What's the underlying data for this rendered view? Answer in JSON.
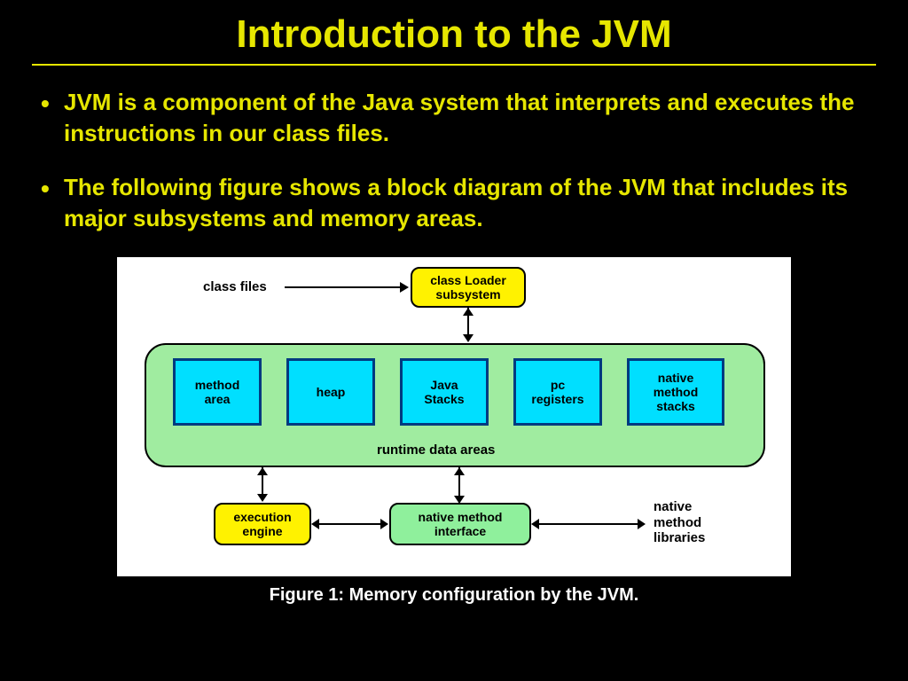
{
  "title": "Introduction to the JVM",
  "bullets": [
    "JVM is a component of the Java system that interprets and executes the instructions in our class files.",
    "The following figure shows a block diagram of the JVM that includes its major subsystems and memory areas."
  ],
  "diagram": {
    "external_labels": {
      "class_files": "class files",
      "native_libs": "native\nmethod\nlibraries"
    },
    "class_loader": "class Loader\nsubsystem",
    "runtime_areas_label": "runtime data areas",
    "runtime_blocks": [
      "method\narea",
      "heap",
      "Java\nStacks",
      "pc\nregisters",
      "native\nmethod\nstacks"
    ],
    "execution_engine": "execution\nengine",
    "native_interface": "native method\ninterface"
  },
  "caption": "Figure 1: Memory configuration by the JVM."
}
